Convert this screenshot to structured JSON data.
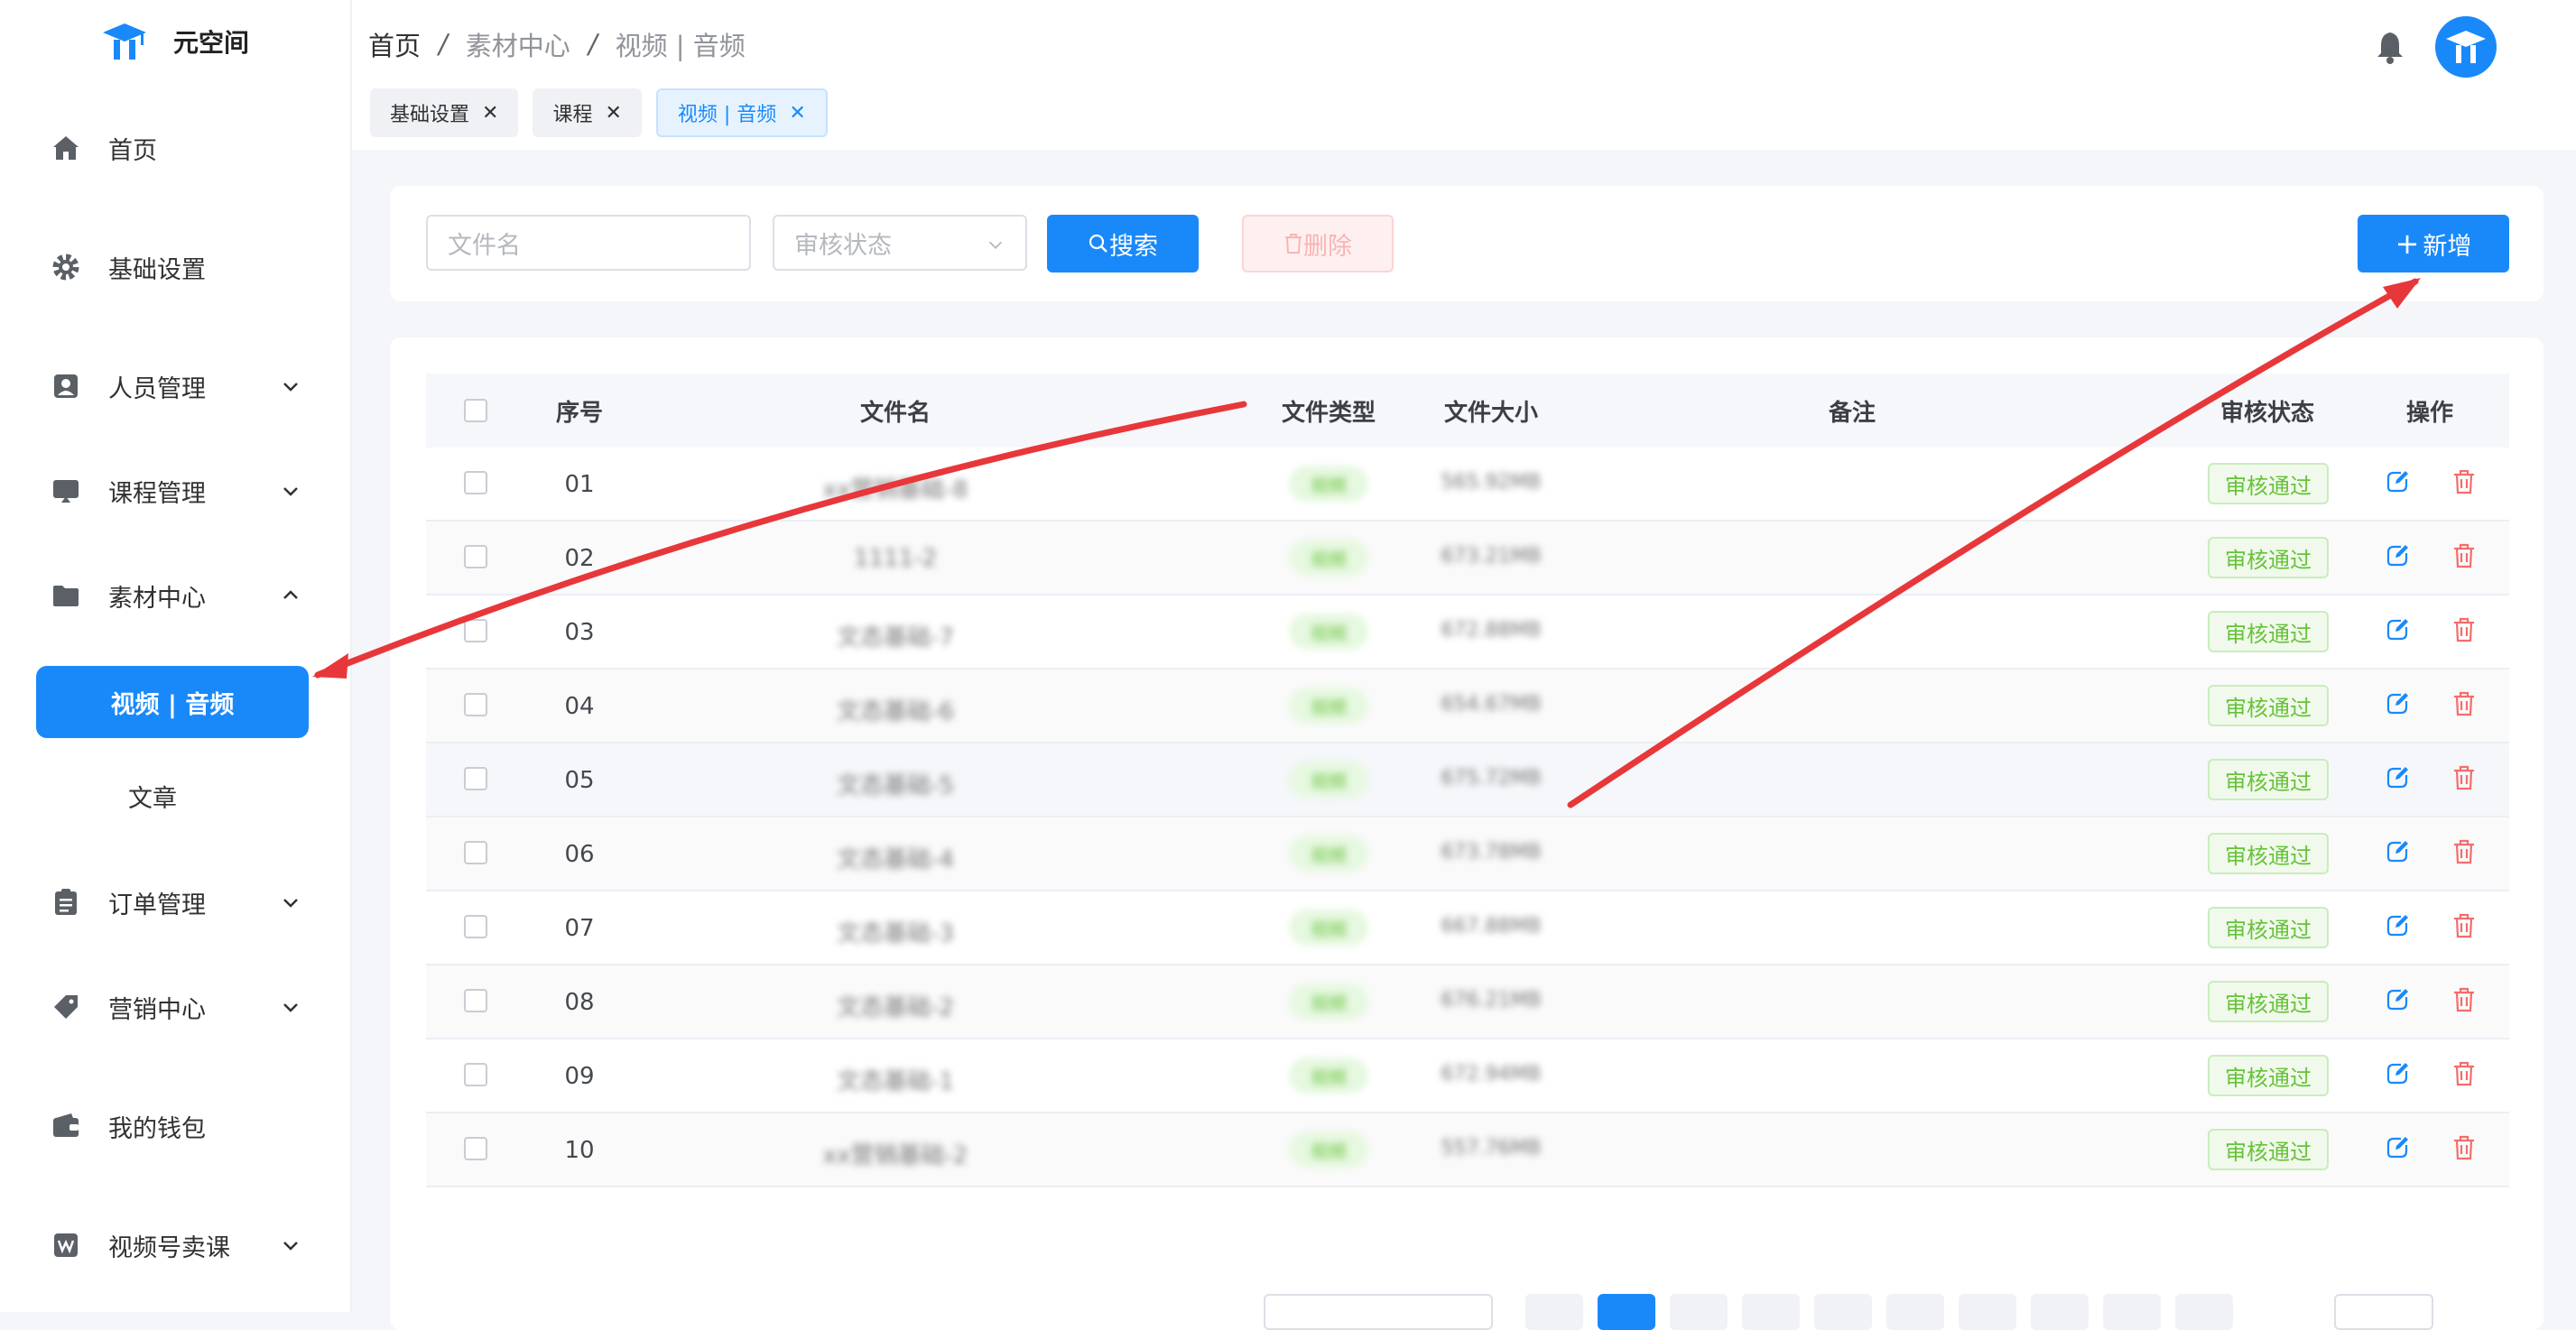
{
  "app": {
    "name": "元空间"
  },
  "sidebar": {
    "items": [
      {
        "label": "首页",
        "icon": "home-icon"
      },
      {
        "label": "基础设置",
        "icon": "gear-icon"
      },
      {
        "label": "人员管理",
        "icon": "user-card-icon"
      },
      {
        "label": "课程管理",
        "icon": "screen-icon"
      },
      {
        "label": "素材中心",
        "icon": "folder-icon"
      },
      {
        "label": "订单管理",
        "icon": "clipboard-icon"
      },
      {
        "label": "营销中心",
        "icon": "tag-icon"
      },
      {
        "label": "我的钱包",
        "icon": "wallet-icon"
      },
      {
        "label": "视频号卖课",
        "icon": "video-channel-icon"
      }
    ],
    "sub_items": [
      {
        "label": "视频 | 音频",
        "active": true
      },
      {
        "label": "文章",
        "active": false
      }
    ]
  },
  "breadcrumb": [
    "首页",
    "素材中心",
    "视频 | 音频"
  ],
  "tabs": [
    {
      "label": "基础设置",
      "active": false
    },
    {
      "label": "课程",
      "active": false
    },
    {
      "label": "视频 | 音频",
      "active": true
    }
  ],
  "search": {
    "filename_placeholder": "文件名",
    "status_placeholder": "审核状态",
    "search_label": "搜索",
    "delete_label": "删除",
    "add_label": "新增"
  },
  "table": {
    "headers": [
      "序号",
      "文件名",
      "文件类型",
      "文件大小",
      "备注",
      "审核状态",
      "操作"
    ],
    "rows": [
      {
        "index": "01",
        "name": "xx营销基础-8",
        "type": "视频",
        "size": "565.92MB",
        "status": "审核通过"
      },
      {
        "index": "02",
        "name": "1111-2",
        "type": "视频",
        "size": "673.21MB",
        "status": "审核通过"
      },
      {
        "index": "03",
        "name": "文态基础-7",
        "type": "视频",
        "size": "672.88MB",
        "status": "审核通过"
      },
      {
        "index": "04",
        "name": "文态基础-6",
        "type": "视频",
        "size": "654.67MB",
        "status": "审核通过"
      },
      {
        "index": "05",
        "name": "文态基础-5",
        "type": "视频",
        "size": "675.72MB",
        "status": "审核通过"
      },
      {
        "index": "06",
        "name": "文态基础-4",
        "type": "视频",
        "size": "673.78MB",
        "status": "审核通过"
      },
      {
        "index": "07",
        "name": "文态基础-3",
        "type": "视频",
        "size": "667.88MB",
        "status": "审核通过"
      },
      {
        "index": "08",
        "name": "文态基础-2",
        "type": "视频",
        "size": "676.21MB",
        "status": "审核通过"
      },
      {
        "index": "09",
        "name": "文态基础-1",
        "type": "视频",
        "size": "672.94MB",
        "status": "审核通过"
      },
      {
        "index": "10",
        "name": "xx营销基础-2",
        "type": "视频",
        "size": "557.76MB",
        "status": "审核通过"
      }
    ]
  },
  "colors": {
    "primary": "#1989fa",
    "success": "#67c23a",
    "danger": "#f56c6c",
    "annotation": "#e8373a"
  }
}
